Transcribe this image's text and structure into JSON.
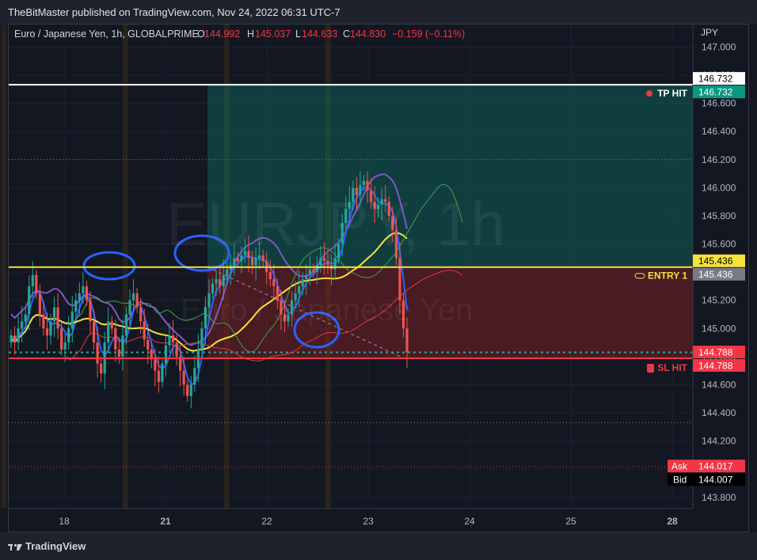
{
  "publisher_line": "TheBitMaster published on TradingView.com, Nov 24, 2022 06:31 UTC-7",
  "legend": {
    "symbol": "Euro / Japanese Yen, 1h, GLOBALPRIME",
    "o_label": "O",
    "o": "144.992",
    "h_label": "H",
    "h": "145.037",
    "l_label": "L",
    "l": "144.633",
    "c_label": "C",
    "c": "144.830",
    "change": "−0.159 (−0.11%)"
  },
  "watermark": {
    "main": "EURJPY, 1h",
    "sub": "Euro / Japanese Yen"
  },
  "brand": "TradingView",
  "chart_data": {
    "type": "candlestick",
    "symbol": "EURJPY",
    "timeframe": "1h",
    "currency": "JPY",
    "ylim": [
      143.72,
      147.16
    ],
    "y_ticks": [
      "147.000",
      "146.800",
      "146.600",
      "146.400",
      "146.200",
      "146.000",
      "145.800",
      "145.600",
      "145.400",
      "145.200",
      "145.000",
      "144.800",
      "144.600",
      "144.400",
      "144.200",
      "144.000",
      "143.800"
    ],
    "x_ticks": [
      {
        "label": "18",
        "day": 0
      },
      {
        "label": "21",
        "day": 1,
        "bold": true
      },
      {
        "label": "22",
        "day": 2
      },
      {
        "label": "23",
        "day": 3
      },
      {
        "label": "24",
        "day": 4
      },
      {
        "label": "25",
        "day": 5
      },
      {
        "label": "28",
        "day": 6,
        "bold": true
      }
    ],
    "levels": {
      "tp": {
        "value": 146.732,
        "label": "TP HIT",
        "color": "#ffffff",
        "tag_color": "#089981"
      },
      "entry": {
        "value": 145.436,
        "label": "ENTRY 1",
        "color": "#f5e33b"
      },
      "sl": {
        "value": 144.788,
        "label": "SL HIT",
        "color": "#f23645"
      }
    },
    "price_tags": [
      {
        "value": "146.732",
        "bg": "#ffffff",
        "fg": "#000000"
      },
      {
        "value": "146.732",
        "bg": "#089981",
        "fg": "#ffffff"
      },
      {
        "value": "145.436",
        "bg": "#f5e33b",
        "fg": "#000000"
      },
      {
        "value": "145.436",
        "bg": "#787b86",
        "fg": "#ffffff"
      },
      {
        "value": "144.788",
        "bg": "#f23645",
        "fg": "#ffffff"
      },
      {
        "value": "144.788",
        "bg": "#f23645",
        "fg": "#ffffff"
      }
    ],
    "ask": {
      "label": "Ask",
      "value": "144.017",
      "color": "#f23645"
    },
    "bid": {
      "label": "Bid",
      "value": "144.007",
      "color": "#000000"
    },
    "closes": [
      144.95,
      144.9,
      145.0,
      145.05,
      145.1,
      145.3,
      145.38,
      145.25,
      145.1,
      145.0,
      144.95,
      145.05,
      145.15,
      145.0,
      144.85,
      144.9,
      145.0,
      145.12,
      145.2,
      145.25,
      145.3,
      145.2,
      145.05,
      144.9,
      144.75,
      144.68,
      144.9,
      145.05,
      145.0,
      144.85,
      144.8,
      144.95,
      145.1,
      145.2,
      145.25,
      145.15,
      145.05,
      144.92,
      144.85,
      144.78,
      144.7,
      144.62,
      144.75,
      144.88,
      144.95,
      144.9,
      144.8,
      144.7,
      144.6,
      144.52,
      144.6,
      144.72,
      144.85,
      145.0,
      145.15,
      145.25,
      145.32,
      145.35,
      145.3,
      145.38,
      145.42,
      145.45,
      145.5,
      145.48,
      145.52,
      145.55,
      145.5,
      145.45,
      145.5,
      145.52,
      145.48,
      145.4,
      145.35,
      145.3,
      145.2,
      145.1,
      145.05,
      145.1,
      145.2,
      145.25,
      145.3,
      145.35,
      145.38,
      145.42,
      145.4,
      145.45,
      145.5,
      145.48,
      145.45,
      145.42,
      145.5,
      145.6,
      145.75,
      145.85,
      145.9,
      146.0,
      145.95,
      146.02,
      146.05,
      145.98,
      145.9,
      145.85,
      145.88,
      145.92,
      145.9,
      145.8,
      145.7,
      145.5,
      145.2,
      145.0,
      144.83
    ],
    "price_change_pct": -0.11
  }
}
